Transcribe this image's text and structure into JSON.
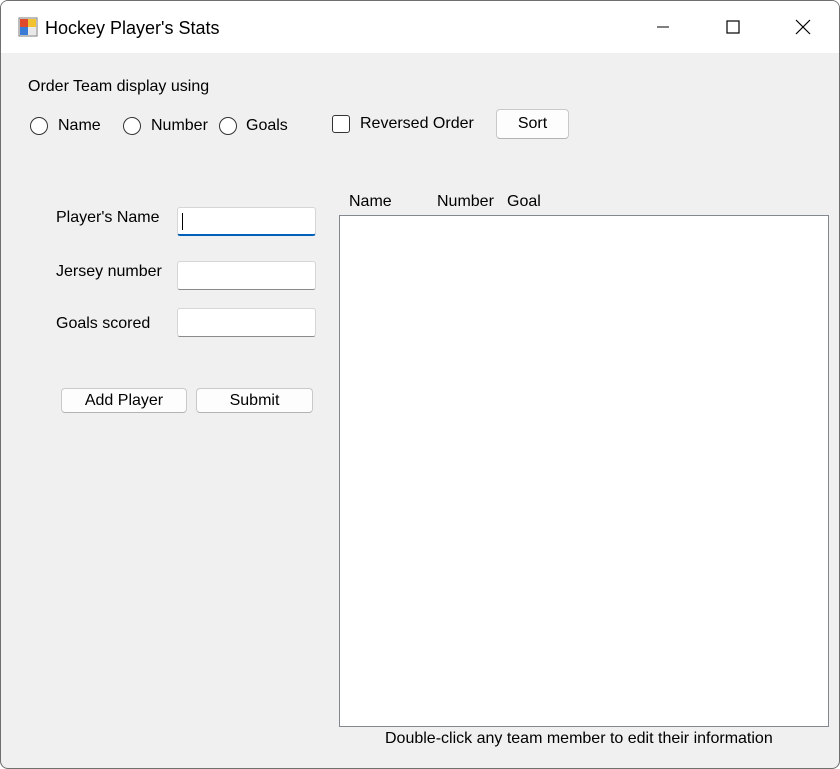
{
  "window": {
    "title": "Hockey Player's Stats",
    "icons": {
      "app": "app-form-icon",
      "minimize": "minimize-icon",
      "maximize": "maximize-icon",
      "close": "close-icon"
    }
  },
  "sort": {
    "label": "Order Team display using",
    "options": [
      "Name",
      "Number",
      "Goals"
    ],
    "reversed_label": "Reversed Order",
    "reversed_checked": false,
    "sort_button": "Sort"
  },
  "form": {
    "name_label": "Player's Name",
    "name_value": "",
    "jersey_label": "Jersey number",
    "jersey_value": "",
    "goals_label": "Goals scored",
    "goals_value": "",
    "add_button": "Add Player",
    "submit_button": "Submit"
  },
  "team_list": {
    "columns": [
      "Name",
      "Number",
      "Goal"
    ],
    "rows": [],
    "hint": "Double-click any team member to edit their information"
  }
}
